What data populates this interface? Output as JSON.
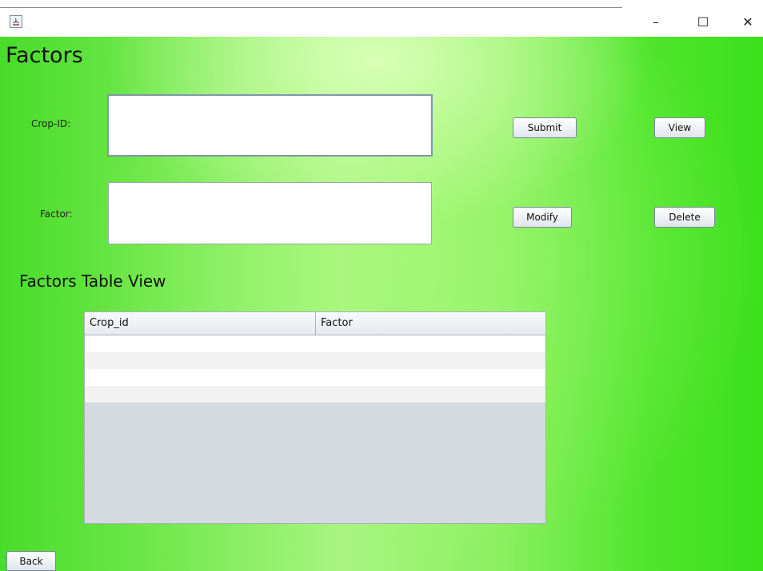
{
  "window": {
    "controls": {
      "minimize": "–",
      "maximize": "☐",
      "close": "✕"
    }
  },
  "form": {
    "title": "Factors",
    "crop_id_label": "Crop-ID:",
    "crop_id_value": "",
    "factor_label": "Factor:",
    "factor_value": ""
  },
  "buttons": {
    "submit": "Submit",
    "view": "View",
    "modify": "Modify",
    "delete": "Delete",
    "back": "Back"
  },
  "table": {
    "title": "Factors Table View",
    "columns": [
      "Crop_id",
      "Factor"
    ],
    "rows": []
  },
  "colors": {
    "background_green": "#3de01b",
    "highlight_green": "#d8ffb6"
  }
}
